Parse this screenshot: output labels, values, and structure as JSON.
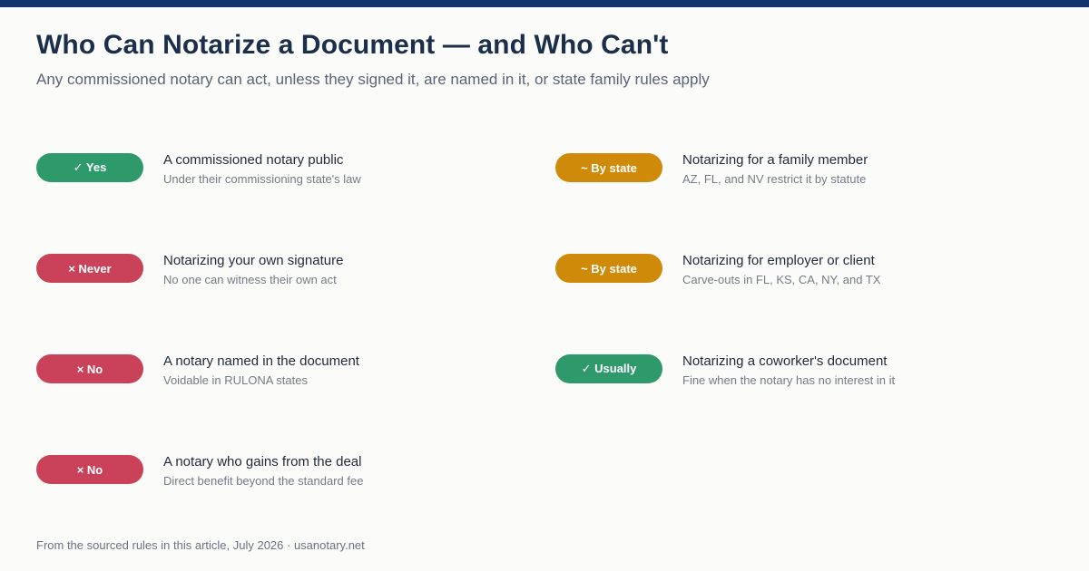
{
  "header": {
    "title": "Who Can Notarize a Document — and Who Can't",
    "subtitle": "Any commissioned notary can act, unless they signed it, are named in it, or state family rules apply"
  },
  "colors": {
    "top_bar": "#12356b",
    "yes": "#2e9a6b",
    "no": "#c94259",
    "by_state": "#d08a0a"
  },
  "left_items": [
    {
      "badge": "✓ Yes",
      "status": "yes",
      "title": "A commissioned notary public",
      "desc": "Under their commissioning state's law"
    },
    {
      "badge": "× Never",
      "status": "no",
      "title": "Notarizing your own signature",
      "desc": "No one can witness their own act"
    },
    {
      "badge": "× No",
      "status": "no",
      "title": "A notary named in the document",
      "desc": "Voidable in RULONA states"
    },
    {
      "badge": "× No",
      "status": "no",
      "title": "A notary who gains from the deal",
      "desc": "Direct benefit beyond the standard fee"
    }
  ],
  "right_items": [
    {
      "badge": "~ By state",
      "status": "by-state",
      "title": "Notarizing for a family member",
      "desc": "AZ, FL, and NV restrict it by statute"
    },
    {
      "badge": "~ By state",
      "status": "by-state",
      "title": "Notarizing for employer or client",
      "desc": "Carve-outs in FL, KS, CA, NY, and TX"
    },
    {
      "badge": "✓ Usually",
      "status": "yes",
      "title": "Notarizing a coworker's document",
      "desc": "Fine when the notary has no interest in it"
    }
  ],
  "footer": {
    "source": "From the sourced rules in this article, July 2026 · usanotary.net"
  }
}
